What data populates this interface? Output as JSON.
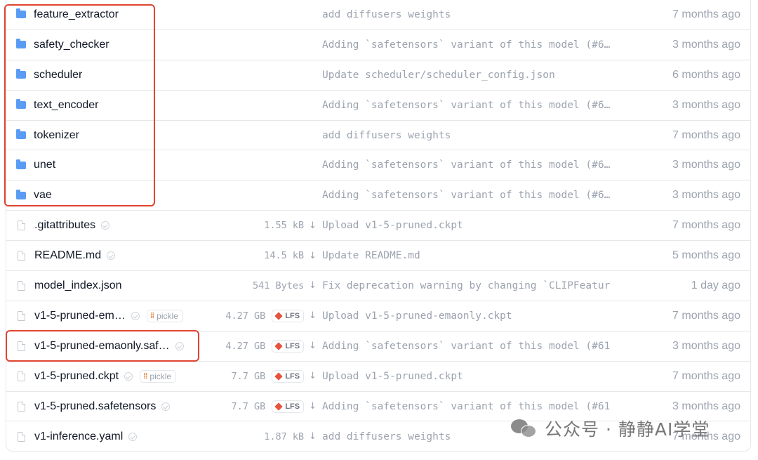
{
  "files": [
    {
      "type": "folder",
      "name": "feature_extractor",
      "commit": "add diffusers weights",
      "time": "7 months ago"
    },
    {
      "type": "folder",
      "name": "safety_checker",
      "commit": "Adding `safetensors` variant of this model (#6…",
      "time": "3 months ago"
    },
    {
      "type": "folder",
      "name": "scheduler",
      "commit": "Update scheduler/scheduler_config.json",
      "time": "6 months ago"
    },
    {
      "type": "folder",
      "name": "text_encoder",
      "commit": "Adding `safetensors` variant of this model (#6…",
      "time": "3 months ago"
    },
    {
      "type": "folder",
      "name": "tokenizer",
      "commit": "add diffusers weights",
      "time": "7 months ago"
    },
    {
      "type": "folder",
      "name": "unet",
      "commit": "Adding `safetensors` variant of this model (#6…",
      "time": "3 months ago"
    },
    {
      "type": "folder",
      "name": "vae",
      "commit": "Adding `safetensors` variant of this model (#6…",
      "time": "3 months ago"
    },
    {
      "type": "file",
      "name": ".gitattributes",
      "safe": true,
      "size": "1.55 kB",
      "commit": "Upload v1-5-pruned.ckpt",
      "time": "7 months ago"
    },
    {
      "type": "file",
      "name": "README.md",
      "safe": true,
      "size": "14.5 kB",
      "commit": "Update README.md",
      "time": "5 months ago"
    },
    {
      "type": "file",
      "name": "model_index.json",
      "safe": false,
      "size": "541 Bytes",
      "commit": "Fix deprecation warning by changing `CLIPFeatur",
      "time": "1 day ago"
    },
    {
      "type": "file",
      "name": "v1-5-pruned-em…",
      "safe": true,
      "pickle": "pickle",
      "size": "4.27 GB",
      "lfs": "LFS",
      "commit": "Upload v1-5-pruned-emaonly.ckpt",
      "time": "7 months ago"
    },
    {
      "type": "file",
      "name": "v1-5-pruned-emaonly.saf…",
      "safe": true,
      "size": "4.27 GB",
      "lfs": "LFS",
      "commit": "Adding `safetensors` variant of this model (#61",
      "time": "3 months ago"
    },
    {
      "type": "file",
      "name": "v1-5-pruned.ckpt",
      "safe": true,
      "pickle": "pickle",
      "size": "7.7 GB",
      "lfs": "LFS",
      "commit": "Upload v1-5-pruned.ckpt",
      "time": "7 months ago"
    },
    {
      "type": "file",
      "name": "v1-5-pruned.safetensors",
      "safe": true,
      "size": "7.7 GB",
      "lfs": "LFS",
      "commit": "Adding `safetensors` variant of this model (#61",
      "time": "3 months ago"
    },
    {
      "type": "file",
      "name": "v1-inference.yaml",
      "safe": true,
      "size": "1.87 kB",
      "commit": "add diffusers weights",
      "time": "7 months ago"
    }
  ],
  "download_glyph": "↓",
  "pickle_glyph": "⁞⁞",
  "colors": {
    "highlight": "#e0442f",
    "folder": "#5a9cf3",
    "lfs": "#e5533d"
  },
  "watermark": {
    "text": "公众号 · 静静AI学堂"
  }
}
